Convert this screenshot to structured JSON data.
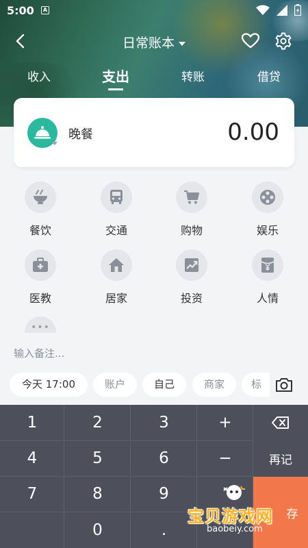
{
  "status_bar": {
    "time": "5:00",
    "app_indicator": "A"
  },
  "topbar": {
    "book_title": "日常账本"
  },
  "tabs": [
    {
      "label": "收入"
    },
    {
      "label": "支出",
      "active": true
    },
    {
      "label": "转账"
    },
    {
      "label": "借贷"
    }
  ],
  "entry": {
    "category": "晚餐",
    "amount": "0.00",
    "category_icon": "cloche-icon",
    "accent": "#2ab89e"
  },
  "categories": [
    {
      "label": "餐饮",
      "icon": "rice-bowl-icon"
    },
    {
      "label": "交通",
      "icon": "bus-icon"
    },
    {
      "label": "购物",
      "icon": "cart-icon"
    },
    {
      "label": "娱乐",
      "icon": "film-reel-icon"
    },
    {
      "label": "医教",
      "icon": "medical-kit-icon"
    },
    {
      "label": "居家",
      "icon": "home-icon"
    },
    {
      "label": "投资",
      "icon": "trend-chart-icon"
    },
    {
      "label": "人情",
      "icon": "red-envelope-icon"
    }
  ],
  "note": {
    "placeholder": "输入备注..."
  },
  "chips": [
    {
      "label": "今天 17:00"
    },
    {
      "label": "账户"
    },
    {
      "label": "自己"
    },
    {
      "label": "商家"
    },
    {
      "label": "标"
    }
  ],
  "keypad": {
    "keys": [
      "1",
      "2",
      "3",
      "+",
      "4",
      "5",
      "6",
      "−",
      "7",
      "8",
      "9",
      "0",
      "."
    ],
    "again_label": "再记",
    "save_label": "存"
  },
  "watermark": {
    "title": "宝贝游戏网",
    "url": "baobeiy.com"
  },
  "colors": {
    "save": "#f2784b",
    "keypad_bg": "#4d505b",
    "page_bg": "#f3f4f6"
  }
}
